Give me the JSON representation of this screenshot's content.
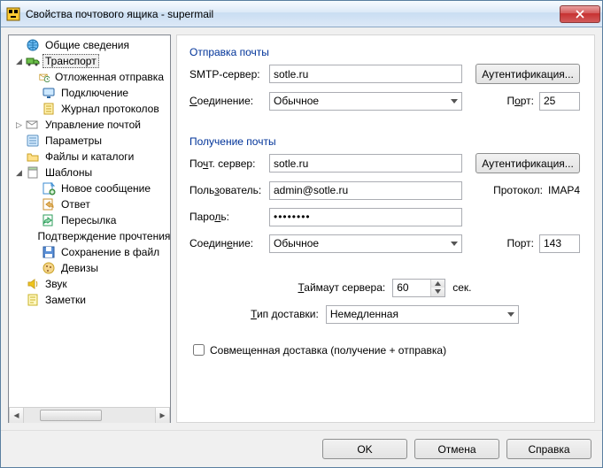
{
  "window": {
    "title": "Свойства почтового ящика - supermail"
  },
  "tree": {
    "general": "Общие сведения",
    "transport": "Транспорт",
    "delayed_send": "Отложенная отправка",
    "connection": "Подключение",
    "protocol_log": "Журнал протоколов",
    "mail_mgmt": "Управление почтой",
    "options": "Параметры",
    "files_dirs": "Файлы и каталоги",
    "templates": "Шаблоны",
    "new_msg": "Новое сообщение",
    "reply": "Ответ",
    "forward": "Пересылка",
    "read_confirm": "Подтверждение прочтения",
    "save_to_file": "Сохранение в файл",
    "cookies": "Девизы",
    "sound": "Звук",
    "notes": "Заметки"
  },
  "send": {
    "title": "Отправка почты",
    "smtp_label": "SMTP-сервер:",
    "smtp_value": "sotle.ru",
    "auth_btn": "Аутентификация...",
    "conn_label": "Соединение:",
    "conn_label_u": "С",
    "conn_value": "Обычное",
    "port_label": "Порт:",
    "port_label_u": "о",
    "port_value": "25"
  },
  "recv": {
    "title": "Получение почты",
    "server_label": "Почт. сервер:",
    "server_label_u": "ч",
    "server_value": "sotle.ru",
    "auth_btn": "Аутентификация...",
    "user_label": "Пользователь:",
    "user_label_u": "з",
    "user_value": "admin@sotle.ru",
    "proto_label": "Протокол:",
    "proto_value": "IMAP4",
    "pass_label": "Пароль:",
    "pass_label_u": "л",
    "pass_value": "••••••••",
    "conn_label": "Соединение:",
    "conn_label_u": "е",
    "conn_value": "Обычное",
    "port_label": "Порт:",
    "port_value": "143"
  },
  "misc": {
    "timeout_label": "Таймаут сервера:",
    "timeout_label_u": "Т",
    "timeout_value": "60",
    "timeout_unit": "сек.",
    "delivery_label": "Тип доставки:",
    "delivery_label_u": "Т",
    "delivery_value": "Немедленная",
    "combined_label": "Совмещенная доставка (получение + отправка)"
  },
  "footer": {
    "ok": "OK",
    "cancel": "Отмена",
    "help": "Справка"
  }
}
